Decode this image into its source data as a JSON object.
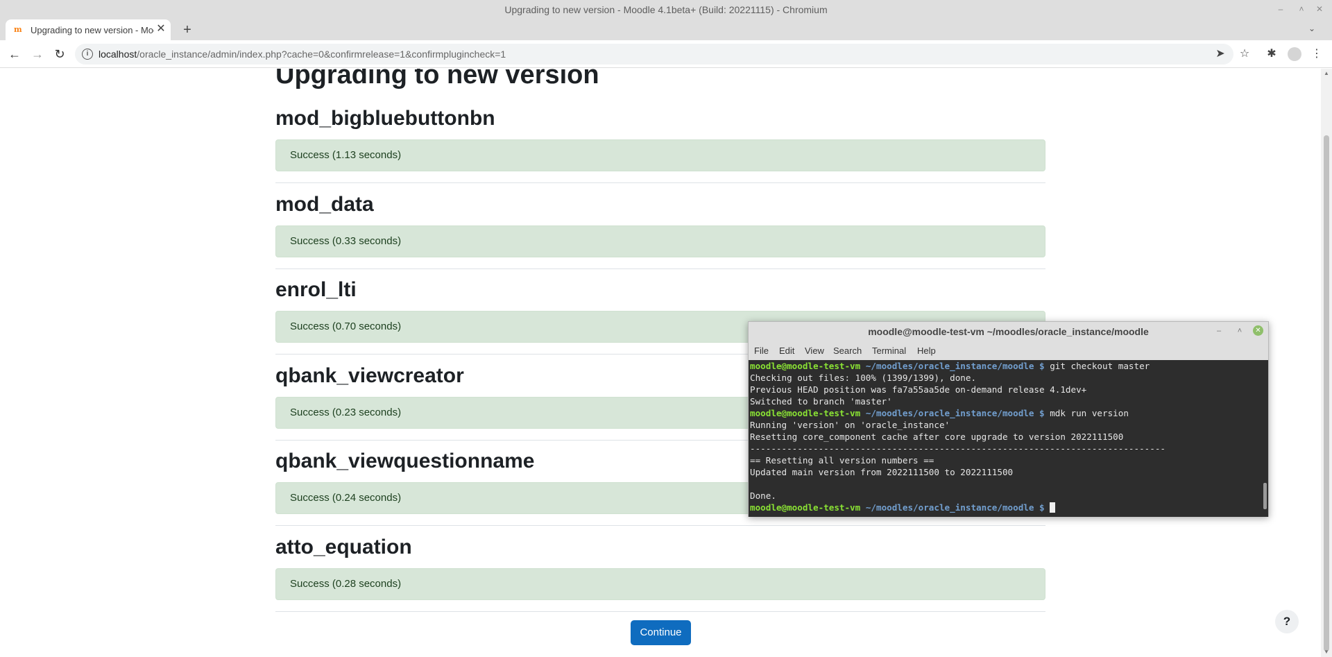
{
  "window": {
    "title": "Upgrading to new version - Moodle 4.1beta+ (Build: 20221115) - Chromium",
    "minimize_glyph": "–",
    "maximize_glyph": "˄",
    "close_glyph": "✕"
  },
  "tabs": [
    {
      "label": "Upgrading to new version - Moodle",
      "favicon": "m",
      "close_glyph": "✕"
    }
  ],
  "tabstrip": {
    "new_tab_glyph": "+",
    "tab_menu_glyph": "⌄"
  },
  "toolbar": {
    "back_glyph": "←",
    "forward_glyph": "→",
    "reload_glyph": "↻",
    "info_glyph": "i",
    "url_host": "localhost",
    "url_path": "/oracle_instance/admin/index.php?cache=0&confirmrelease=1&confirmplugincheck=1",
    "send_glyph": "➤",
    "bookmark_glyph": "☆",
    "extensions_glyph": "✱",
    "menu_glyph": "⋮"
  },
  "page": {
    "heading": "Upgrading to new version",
    "plugins": [
      {
        "name": "mod_bigbluebuttonbn",
        "result": "Success (1.13 seconds)"
      },
      {
        "name": "mod_data",
        "result": "Success (0.33 seconds)"
      },
      {
        "name": "enrol_lti",
        "result": "Success (0.70 seconds)"
      },
      {
        "name": "qbank_viewcreator",
        "result": "Success (0.23 seconds)"
      },
      {
        "name": "qbank_viewquestionname",
        "result": "Success (0.24 seconds)"
      },
      {
        "name": "atto_equation",
        "result": "Success (0.28 seconds)"
      }
    ],
    "continue_label": "Continue",
    "help_label": "?"
  },
  "terminal": {
    "title": "moodle@moodle-test-vm ~/moodles/oracle_instance/moodle",
    "menu": [
      "File",
      "Edit",
      "View",
      "Search",
      "Terminal",
      "Help"
    ],
    "prompt_user": "moodle@moodle-test-vm",
    "prompt_path": "~/moodles/oracle_instance/moodle",
    "prompt_symbol": "$",
    "lines": [
      {
        "type": "cmd",
        "text": "git checkout master"
      },
      {
        "type": "out",
        "text": "Checking out files: 100% (1399/1399), done."
      },
      {
        "type": "out",
        "text": "Previous HEAD position was fa7a55aa5de on-demand release 4.1dev+"
      },
      {
        "type": "out",
        "text": "Switched to branch 'master'"
      },
      {
        "type": "cmd",
        "text": "mdk run version"
      },
      {
        "type": "out",
        "text": "Running 'version' on 'oracle_instance'"
      },
      {
        "type": "out",
        "text": "Resetting core_component cache after core upgrade to version 2022111500"
      },
      {
        "type": "out",
        "text": "-------------------------------------------------------------------------------"
      },
      {
        "type": "out",
        "text": "== Resetting all version numbers =="
      },
      {
        "type": "out",
        "text": "Updated main version from 2022111500 to 2022111500"
      },
      {
        "type": "out",
        "text": ""
      },
      {
        "type": "out",
        "text": "Done."
      },
      {
        "type": "cmd",
        "text": ""
      }
    ]
  }
}
